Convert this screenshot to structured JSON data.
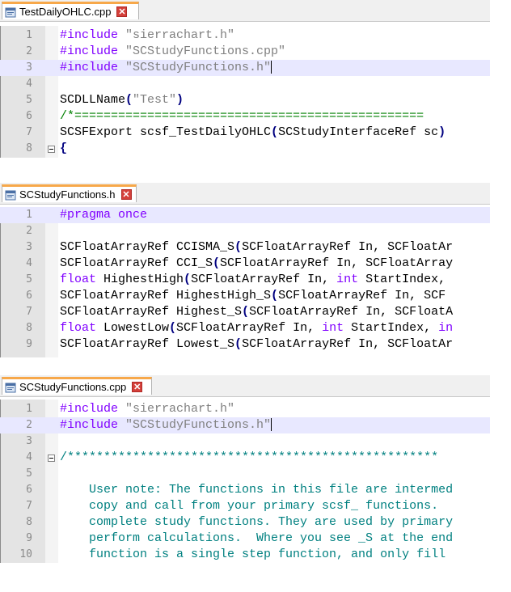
{
  "panes": [
    {
      "tab_label": "TestDailyOHLC.cpp",
      "lines": [
        {
          "n": "1",
          "tokens": [
            [
              "kw",
              "#include "
            ],
            [
              "str",
              "\"sierrachart.h\""
            ]
          ]
        },
        {
          "n": "2",
          "tokens": [
            [
              "kw",
              "#include "
            ],
            [
              "str",
              "\"SCStudyFunctions.cpp\""
            ]
          ]
        },
        {
          "n": "3",
          "tokens": [
            [
              "kw",
              "#include "
            ],
            [
              "str",
              "\"SCStudyFunctions.h\""
            ]
          ],
          "current": true,
          "caret": true
        },
        {
          "n": "4",
          "tokens": []
        },
        {
          "n": "5",
          "tokens": [
            [
              "plain",
              "SCDLLName"
            ],
            [
              "paren",
              "("
            ],
            [
              "str",
              "\"Test\""
            ],
            [
              "paren",
              ")"
            ]
          ]
        },
        {
          "n": "6",
          "tokens": [
            [
              "cmt",
              "/*================================================"
            ]
          ]
        },
        {
          "n": "7",
          "tokens": [
            [
              "plain",
              "SCSFExport scsf_TestDailyOHLC"
            ],
            [
              "paren",
              "("
            ],
            [
              "plain",
              "SCStudyInterfaceRef sc"
            ],
            [
              "paren",
              ")"
            ]
          ]
        },
        {
          "n": "8",
          "tokens": [
            [
              "paren",
              "{"
            ]
          ],
          "fold": true
        }
      ]
    },
    {
      "tab_label": "SCStudyFunctions.h",
      "lines": [
        {
          "n": "1",
          "tokens": [
            [
              "kw",
              "#pragma once"
            ]
          ],
          "current": true
        },
        {
          "n": "2",
          "tokens": []
        },
        {
          "n": "3",
          "tokens": [
            [
              "plain",
              "SCFloatArrayRef CCISMA_S"
            ],
            [
              "paren",
              "("
            ],
            [
              "plain",
              "SCFloatArrayRef In, SCFloatAr"
            ]
          ]
        },
        {
          "n": "4",
          "tokens": [
            [
              "plain",
              "SCFloatArrayRef CCI_S"
            ],
            [
              "paren",
              "("
            ],
            [
              "plain",
              "SCFloatArrayRef In, SCFloatArray"
            ]
          ]
        },
        {
          "n": "5",
          "tokens": [
            [
              "type",
              "float"
            ],
            [
              "plain",
              " HighestHigh"
            ],
            [
              "paren",
              "("
            ],
            [
              "plain",
              "SCFloatArrayRef In, "
            ],
            [
              "type",
              "int"
            ],
            [
              "plain",
              " StartIndex,"
            ]
          ]
        },
        {
          "n": "6",
          "tokens": [
            [
              "plain",
              "SCFloatArrayRef HighestHigh_S"
            ],
            [
              "paren",
              "("
            ],
            [
              "plain",
              "SCFloatArrayRef In, SCF"
            ]
          ]
        },
        {
          "n": "7",
          "tokens": [
            [
              "plain",
              "SCFloatArrayRef Highest_S"
            ],
            [
              "paren",
              "("
            ],
            [
              "plain",
              "SCFloatArrayRef In, SCFloatA"
            ]
          ]
        },
        {
          "n": "8",
          "tokens": [
            [
              "type",
              "float"
            ],
            [
              "plain",
              " LowestLow"
            ],
            [
              "paren",
              "("
            ],
            [
              "plain",
              "SCFloatArrayRef In, "
            ],
            [
              "type",
              "int"
            ],
            [
              "plain",
              " StartIndex, "
            ],
            [
              "type",
              "in"
            ]
          ]
        },
        {
          "n": "9",
          "tokens": [
            [
              "plain",
              "SCFloatArrayRef Lowest_S"
            ],
            [
              "paren",
              "("
            ],
            [
              "plain",
              "SCFloatArrayRef In, SCFloatAr"
            ]
          ]
        }
      ]
    },
    {
      "tab_label": "SCStudyFunctions.cpp",
      "lines": [
        {
          "n": "1",
          "tokens": [
            [
              "kw",
              "#include "
            ],
            [
              "str",
              "\"sierrachart.h\""
            ]
          ]
        },
        {
          "n": "2",
          "tokens": [
            [
              "kw",
              "#include "
            ],
            [
              "str",
              "\"SCStudyFunctions.h\""
            ]
          ],
          "current": true,
          "caret": true
        },
        {
          "n": "3",
          "tokens": []
        },
        {
          "n": "4",
          "tokens": [
            [
              "cmtdoc",
              "/***************************************************"
            ]
          ],
          "fold": true
        },
        {
          "n": "5",
          "tokens": []
        },
        {
          "n": "6",
          "tokens": [
            [
              "cmtdoc",
              "    User note: The functions in this file are intermed"
            ]
          ]
        },
        {
          "n": "7",
          "tokens": [
            [
              "cmtdoc",
              "    copy and call from your primary scsf_ functions."
            ]
          ]
        },
        {
          "n": "8",
          "tokens": [
            [
              "cmtdoc",
              "    complete study functions. They are used by primary"
            ]
          ]
        },
        {
          "n": "9",
          "tokens": [
            [
              "cmtdoc",
              "    perform calculations.  Where you see _S at the end"
            ]
          ]
        },
        {
          "n": "10",
          "tokens": [
            [
              "cmtdoc",
              "    function is a single step function, and only fill"
            ]
          ]
        }
      ]
    }
  ]
}
